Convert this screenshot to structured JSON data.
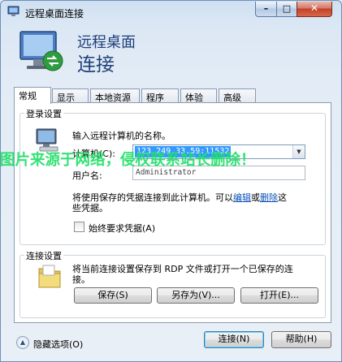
{
  "window": {
    "title": "远程桌面连接"
  },
  "banner": {
    "line1": "远程桌面",
    "line2": "连接"
  },
  "tabs": [
    {
      "label": "常规",
      "active": true
    },
    {
      "label": "显示",
      "active": false
    },
    {
      "label": "本地资源",
      "active": false
    },
    {
      "label": "程序",
      "active": false
    },
    {
      "label": "体验",
      "active": false
    },
    {
      "label": "高级",
      "active": false
    }
  ],
  "login": {
    "group_title": "登录设置",
    "prompt": "输入远程计算机的名称。",
    "computer_label": "计算机(C):",
    "computer_value": "123.249.33.59:11532",
    "username_label": "用户名:",
    "username_value": "Administrator",
    "info_part1": "将使用保存的凭据连接到此计算机。可以",
    "info_edit": "编辑",
    "info_or": "或",
    "info_delete": "删除",
    "info_part2": "这",
    "info_part3": "些凭据。",
    "always_ask_label": "始终要求凭据(A)"
  },
  "connection": {
    "group_title": "连接设置",
    "desc_line1": "将当前连接设置保存到 RDP 文件或打开一个已保存的连",
    "desc_line2": "接。",
    "save": "保存(S)",
    "save_as": "另存为(V)...",
    "open": "打开(E)..."
  },
  "footer": {
    "hide_options": "隐藏选项(O)",
    "connect": "连接(N)",
    "help": "帮助(H)"
  },
  "watermark": "图片来源于网络，侵权联系站长删除！",
  "colors": {
    "banner_text": "#1d3f78",
    "link": "#0b52b6",
    "selection": "#3399ff",
    "watermark": "#22e06a"
  }
}
